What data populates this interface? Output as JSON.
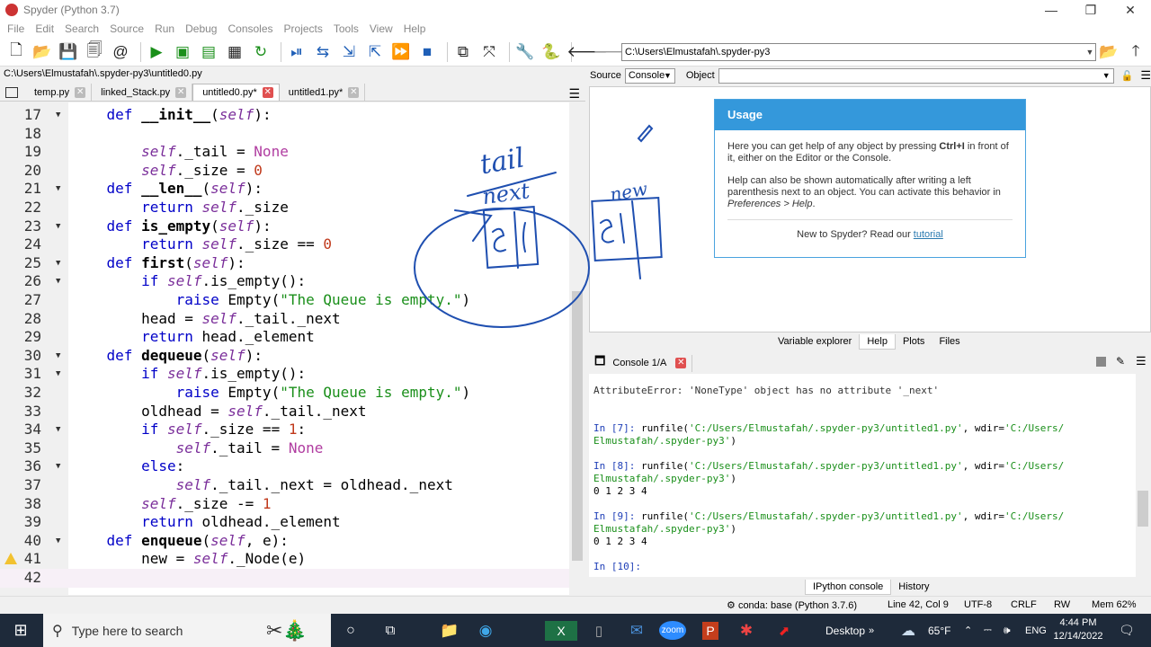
{
  "window": {
    "title": "Spyder (Python 3.7)",
    "min": "—",
    "max": "❐",
    "close": "✕"
  },
  "menu": [
    "File",
    "Edit",
    "Search",
    "Source",
    "Run",
    "Debug",
    "Consoles",
    "Projects",
    "Tools",
    "View",
    "Help"
  ],
  "toolbar": {
    "path": "C:\\Users\\Elmustafah\\.spyder-py3",
    "icons": [
      "new-file-icon",
      "open-folder-icon",
      "save-icon",
      "save-all-icon",
      "at-icon",
      "run-icon",
      "run-cell-icon",
      "run-cell-advance-icon",
      "run-selection-icon",
      "rerun-icon",
      "debug-icon",
      "step-icon",
      "step-into-icon",
      "step-return-icon",
      "continue-icon",
      "stop-icon",
      "maximize-pane-icon",
      "fullscreen-icon",
      "preferences-icon",
      "python-path-icon",
      "back-arrow-icon",
      "forward-arrow-icon",
      "browse-dir-icon",
      "parent-dir-icon"
    ]
  },
  "editor": {
    "file_path": "C:\\Users\\Elmustafah\\.spyder-py3\\untitled0.py",
    "tabs": [
      {
        "label": "temp.py",
        "active": false
      },
      {
        "label": "linked_Stack.py",
        "active": false
      },
      {
        "label": "untitled0.py*",
        "active": true
      },
      {
        "label": "untitled1.py*",
        "active": false
      }
    ],
    "lines": [
      {
        "n": "17",
        "fold": true,
        "html": "    <span class='kw'>def</span> <span class='fn'>__init__</span>(<span class='slf'>self</span>):"
      },
      {
        "n": "18",
        "fold": false,
        "html": ""
      },
      {
        "n": "19",
        "fold": false,
        "html": "        <span class='slf'>self</span>._tail = <span class='cst'>None</span>"
      },
      {
        "n": "20",
        "fold": false,
        "html": "        <span class='slf'>self</span>._size = <span class='num'>0</span>"
      },
      {
        "n": "21",
        "fold": true,
        "html": "    <span class='kw'>def</span> <span class='fn'>__len__</span>(<span class='slf'>self</span>):"
      },
      {
        "n": "22",
        "fold": false,
        "html": "        <span class='kw'>return</span> <span class='slf'>self</span>._size"
      },
      {
        "n": "23",
        "fold": true,
        "html": "    <span class='kw'>def</span> <span class='fn'>is_empty</span>(<span class='slf'>self</span>):"
      },
      {
        "n": "24",
        "fold": false,
        "html": "        <span class='kw'>return</span> <span class='slf'>self</span>._size == <span class='num'>0</span>"
      },
      {
        "n": "25",
        "fold": true,
        "html": "    <span class='kw'>def</span> <span class='fn'>first</span>(<span class='slf'>self</span>):"
      },
      {
        "n": "26",
        "fold": true,
        "html": "        <span class='kw'>if</span> <span class='slf'>self</span>.is_empty():"
      },
      {
        "n": "27",
        "fold": false,
        "html": "            <span class='kw'>raise</span> Empty(<span class='str'>\"The Queue is empty.\"</span>)"
      },
      {
        "n": "28",
        "fold": false,
        "html": "        head = <span class='slf'>self</span>._tail._next"
      },
      {
        "n": "29",
        "fold": false,
        "html": "        <span class='kw'>return</span> head._element"
      },
      {
        "n": "30",
        "fold": true,
        "html": "    <span class='kw'>def</span> <span class='fn'>dequeue</span>(<span class='slf'>self</span>):"
      },
      {
        "n": "31",
        "fold": true,
        "html": "        <span class='kw'>if</span> <span class='slf'>self</span>.is_empty():"
      },
      {
        "n": "32",
        "fold": false,
        "html": "            <span class='kw'>raise</span> Empty(<span class='str'>\"The Queue is empty.\"</span>)"
      },
      {
        "n": "33",
        "fold": false,
        "html": "        oldhead = <span class='slf'>self</span>._tail._next"
      },
      {
        "n": "34",
        "fold": true,
        "html": "        <span class='kw'>if</span> <span class='slf'>self</span>._size == <span class='num'>1</span>:"
      },
      {
        "n": "35",
        "fold": false,
        "html": "            <span class='slf'>self</span>._tail = <span class='cst'>None</span>"
      },
      {
        "n": "36",
        "fold": true,
        "html": "        <span class='kw'>else</span>:"
      },
      {
        "n": "37",
        "fold": false,
        "html": "            <span class='slf'>self</span>._tail._next = oldhead._next"
      },
      {
        "n": "38",
        "fold": false,
        "html": "        <span class='slf'>self</span>._size -= <span class='num'>1</span>"
      },
      {
        "n": "39",
        "fold": false,
        "html": "        <span class='kw'>return</span> oldhead._element"
      },
      {
        "n": "40",
        "fold": true,
        "html": "    <span class='kw'>def</span> <span class='fn'>enqueue</span>(<span class='slf'>self</span>, e):"
      },
      {
        "n": "41",
        "fold": false,
        "warn": true,
        "html": "        new = <span class='slf'>self</span>._Node(e)"
      },
      {
        "n": "42",
        "fold": false,
        "current": true,
        "html": ""
      }
    ]
  },
  "help": {
    "source_label": "Source",
    "source_value": "Console",
    "object_label": "Object",
    "usage_title": "Usage",
    "usage_p1_a": "Here you can get help of any object by pressing ",
    "usage_p1_key": "Ctrl+I",
    "usage_p1_b": " in front of it, either on the Editor or the Console.",
    "usage_p2_a": "Help can also be shown automatically after writing a left parenthesis next to an object. You can activate this behavior in ",
    "usage_p2_em": "Preferences > Help",
    "usage_p2_b": ".",
    "usage_tail": "New to Spyder? Read our ",
    "usage_link": "tutorial"
  },
  "pane_tabs": [
    {
      "label": "Variable explorer",
      "active": false
    },
    {
      "label": "Help",
      "active": true
    },
    {
      "label": "Plots",
      "active": false
    },
    {
      "label": "Files",
      "active": false
    }
  ],
  "console": {
    "tab": "Console 1/A",
    "error": "AttributeError: 'NoneType' object has no attribute '_next'",
    "runs": [
      {
        "prompt": "In [7]:",
        "cmd": " runfile(",
        "path": "'C:/Users/Elmustafah/.spyder-py3/untitled1.py'",
        "mid": ", wdir=",
        "wdir1": "'C:/Users/",
        "wdir2": "Elmustafah/.spyder-py3'",
        "end": ")",
        "out": ""
      },
      {
        "prompt": "In [8]:",
        "cmd": " runfile(",
        "path": "'C:/Users/Elmustafah/.spyder-py3/untitled1.py'",
        "mid": ", wdir=",
        "wdir1": "'C:/Users/",
        "wdir2": "Elmustafah/.spyder-py3'",
        "end": ")",
        "out": "0 1 2 3 4"
      },
      {
        "prompt": "In [9]:",
        "cmd": " runfile(",
        "path": "'C:/Users/Elmustafah/.spyder-py3/untitled1.py'",
        "mid": ", wdir=",
        "wdir1": "'C:/Users/",
        "wdir2": "Elmustafah/.spyder-py3'",
        "end": ")",
        "out": "0 1 2 3 4"
      }
    ],
    "next_prompt": "In [10]:"
  },
  "console_tabs": [
    {
      "label": "IPython console",
      "active": true
    },
    {
      "label": "History",
      "active": false
    }
  ],
  "status": {
    "conda": "conda: base (Python 3.7.6)",
    "position": "Line 42, Col 9",
    "encoding": "UTF-8",
    "eol": "CRLF",
    "rw": "RW",
    "mem": "Mem 62%"
  },
  "taskbar": {
    "search_placeholder": "Type here to search",
    "desktop": "Desktop",
    "weather": "65°F",
    "lang": "ENG",
    "time": "4:44 PM",
    "date": "12/14/2022"
  },
  "annotations": {
    "tail_word": "tail",
    "next_word": "next",
    "new_word": "new"
  },
  "colors": {
    "accent": "#3498db",
    "ink": "#1f4fb0",
    "keyword": "#0000c8",
    "string": "#1a8f1a"
  }
}
